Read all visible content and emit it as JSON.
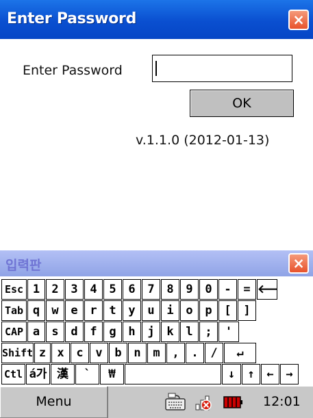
{
  "window": {
    "title": "Enter Password",
    "close_label": "×"
  },
  "form": {
    "password_label": "Enter Password",
    "password_value": "",
    "ok_label": "OK",
    "version": "v.1.1.0 (2012-01-13)"
  },
  "ime": {
    "title": "입력판",
    "close_label": "×"
  },
  "keyboard": {
    "rows": [
      [
        "Esc",
        "1",
        "2",
        "3",
        "4",
        "5",
        "6",
        "7",
        "8",
        "9",
        "0",
        "-",
        "=",
        "🡐"
      ],
      [
        "Tab",
        "q",
        "w",
        "e",
        "r",
        "t",
        "y",
        "u",
        "i",
        "o",
        "p",
        "[",
        "]"
      ],
      [
        "CAP",
        "a",
        "s",
        "d",
        "f",
        "g",
        "h",
        "j",
        "k",
        "l",
        ";",
        "'"
      ],
      [
        "Shift",
        "z",
        "x",
        "c",
        "v",
        "b",
        "n",
        "m",
        ",",
        ".",
        "/",
        "↵"
      ],
      [
        "Ctl",
        "á가",
        "漢",
        "`",
        "₩",
        "",
        "↓",
        "↑",
        "←",
        "→"
      ]
    ]
  },
  "taskbar": {
    "menu_label": "Menu",
    "time": "12:01",
    "tray_icons": [
      "keyboard-icon",
      "network-icon",
      "battery-icon"
    ]
  },
  "colors": {
    "titlebar": "#0a4fd0",
    "close": "#e8532c",
    "ime_bar": "#8fa3e6",
    "battery": "#cc0000"
  }
}
